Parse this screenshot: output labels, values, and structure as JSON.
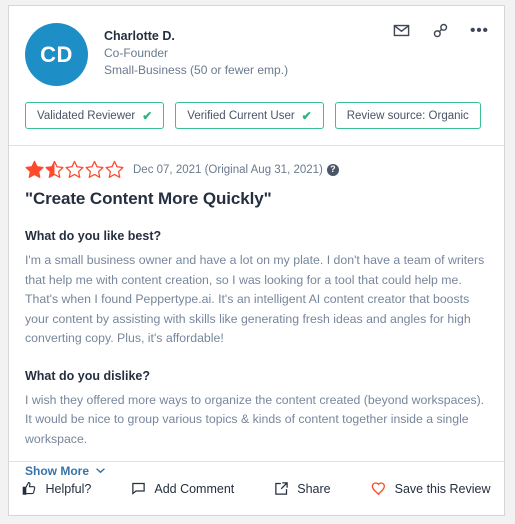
{
  "review": {
    "avatar_initials": "CD",
    "avatar_color": "#1e8fc6",
    "reviewer_name": "Charlotte D.",
    "reviewer_role": "Co-Founder",
    "reviewer_company_size": "Small-Business (50 or fewer emp.)",
    "header_icons": [
      {
        "name": "envelope-icon",
        "label": "Email"
      },
      {
        "name": "link-icon",
        "label": "Copy link"
      },
      {
        "name": "ellipsis-icon",
        "label": "More options"
      }
    ],
    "badges": [
      {
        "label": "Validated Reviewer",
        "check": "✔"
      },
      {
        "label": "Verified Current User",
        "check": "✔"
      },
      {
        "label": "Review source: Organic",
        "check": ""
      }
    ],
    "badge_border_color": "#3bbf96",
    "rating": {
      "value": 1.5,
      "max": 5,
      "star_color": "#ff492c"
    },
    "date": "Dec 07, 2021 (Original Aug 31, 2021)",
    "info_icon_label": "?",
    "title": "\"Create Content More Quickly\"",
    "sections": [
      {
        "question": "What do you like best?",
        "answer": "I'm a small business owner and have a lot on my plate. I don't have a team of writers that help me with content creation, so I was looking for a tool that could help me. That's when I found Peppertype.ai. It's an intelligent AI content creator that boosts your content by assisting with skills like generating fresh ideas and angles for high converting copy. Plus, it's affordable!"
      },
      {
        "question": "What do you dislike?",
        "answer": "I wish they offered more ways to organize the content created (beyond workspaces). It would be nice to group various topics & kinds of content together inside a single workspace."
      }
    ],
    "show_more_label": "Show More",
    "footer_actions": [
      {
        "icon": "thumbs-up-icon",
        "label": "Helpful?"
      },
      {
        "icon": "comment-icon",
        "label": "Add Comment"
      },
      {
        "icon": "share-icon",
        "label": "Share"
      },
      {
        "icon": "heart-icon",
        "label": "Save this Review"
      }
    ],
    "heart_color": "#ff492c"
  }
}
